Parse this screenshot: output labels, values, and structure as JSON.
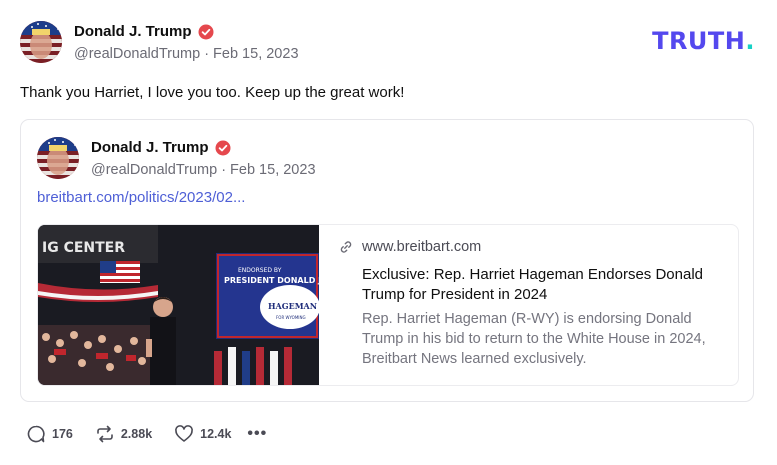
{
  "post": {
    "author_name": "Donald J. Trump",
    "handle": "@realDonaldTrump",
    "date": "Feb 15, 2023",
    "text": "Thank you Harriet, I love you too. Keep up the great work!",
    "verified_icon": "verified-badge-icon"
  },
  "logo": {
    "text": "TRUTH",
    "period": ".",
    "colors": {
      "main": "#5448ee",
      "accent": "#17d1c6"
    }
  },
  "quoted": {
    "author_name": "Donald J. Trump",
    "handle": "@realDonaldTrump",
    "date": "Feb 15, 2023",
    "link_text": "breitbart.com/politics/2023/02...",
    "card": {
      "domain": "www.breitbart.com",
      "headline": "Exclusive: Rep. Harriet Hageman Endorses Donald Trump for President in 2024",
      "description": "Rep. Harriet Hageman (R-WY) is endorsing Donald Trump in his bid to return to the White House in 2024, Breitbart News learned exclusively.",
      "image_texts": {
        "venue_sign": "IG CENTER",
        "banner_small": "ENDORSED BY",
        "banner_main": "PRESIDENT DONALD J.",
        "podium": "HAGEMAN",
        "podium_sub": "FOR WYOMING"
      }
    }
  },
  "actions": {
    "replies": "176",
    "retruths": "2.88k",
    "likes": "12.4k",
    "more_icon": "ellipsis-icon"
  },
  "colors": {
    "accent_link": "#4e5fd6",
    "verified": "#e5484d"
  }
}
